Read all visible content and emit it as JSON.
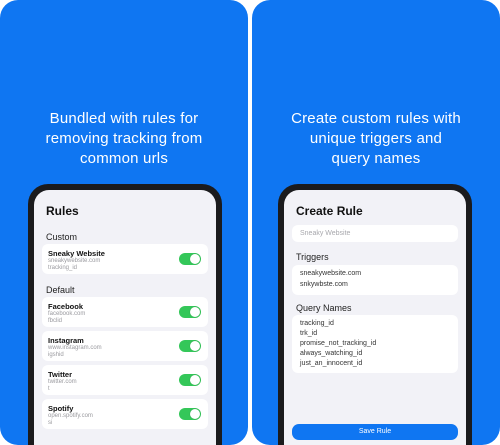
{
  "left_panel": {
    "headline": [
      "Bundled with rules for",
      "removing tracking from",
      "common urls"
    ],
    "screen": {
      "title": "Rules",
      "custom_label": "Custom",
      "custom_rules": [
        {
          "name": "Sneaky Website",
          "domain": "sneakywebsite.com",
          "param": "tracking_id",
          "enabled": true
        }
      ],
      "default_label": "Default",
      "default_rules": [
        {
          "name": "Facebook",
          "domain": "facebook.com",
          "param": "fbclid",
          "enabled": true
        },
        {
          "name": "Instagram",
          "domain": "www.instagram.com",
          "param": "igshid",
          "enabled": true
        },
        {
          "name": "Twitter",
          "domain": "twitter.com",
          "param": "t",
          "enabled": true
        },
        {
          "name": "Spotify",
          "domain": "open.spotify.com",
          "param": "si",
          "enabled": true
        }
      ]
    }
  },
  "right_panel": {
    "headline": [
      "Create custom rules with",
      "unique triggers and",
      "query names"
    ],
    "screen": {
      "title": "Create Rule",
      "name_placeholder": "Sneaky Website",
      "triggers_label": "Triggers",
      "triggers": [
        "sneakywebsite.com",
        "snkywbste.com"
      ],
      "query_names_label": "Query Names",
      "query_names": [
        "tracking_id",
        "trk_id",
        "promise_not_tracking_id",
        "always_watching_id",
        "just_an_innocent_id"
      ],
      "save_label": "Save Rule"
    }
  },
  "colors": {
    "accent": "#0f76f2",
    "toggle_on": "#34c759",
    "screen_bg": "#f2f2f7"
  }
}
